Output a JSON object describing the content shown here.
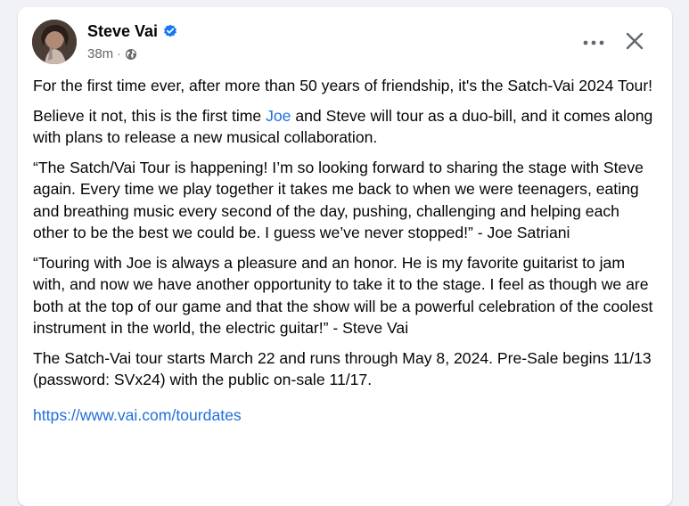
{
  "post": {
    "author": "Steve Vai",
    "time": "38m",
    "separator": "·",
    "icons": {
      "verified": "verified-badge-icon",
      "privacy": "globe-icon",
      "more": "more-options-icon",
      "close": "close-icon"
    },
    "colors": {
      "verified": "#1877f2",
      "link": "#216fdb",
      "meta": "#65676b"
    },
    "paragraphs": {
      "p1": "For the first time ever, after more than 50 years of friendship, it's the Satch-Vai 2024 Tour!",
      "p2_before": "Believe it not, this is the first time ",
      "p2_link": "Joe",
      "p2_after": " and Steve will tour as a duo-bill, and it comes along with plans to release a new musical collaboration.",
      "p3": "“The Satch/Vai Tour is happening! I’m so looking forward to sharing the stage with Steve again. Every time we play together it takes me back to when we were teenagers, eating and breathing music every second of the day, pushing, challenging and helping each other to be the best we could be. I guess we’ve never stopped!” - Joe Satriani",
      "p4": "“Touring with Joe is always a pleasure and an honor. He is my favorite guitarist to jam with, and now we have another opportunity to take it to the stage. I feel as though we are both at the top of our game and that the show will be a powerful celebration of the coolest instrument in the world, the electric guitar!” - Steve Vai",
      "p5": "The Satch-Vai tour starts March 22 and runs through May 8, 2024.  Pre-Sale begins 11/13 (password: SVx24) with the public on-sale 11/17."
    },
    "url": "https://www.vai.com/tourdates"
  }
}
